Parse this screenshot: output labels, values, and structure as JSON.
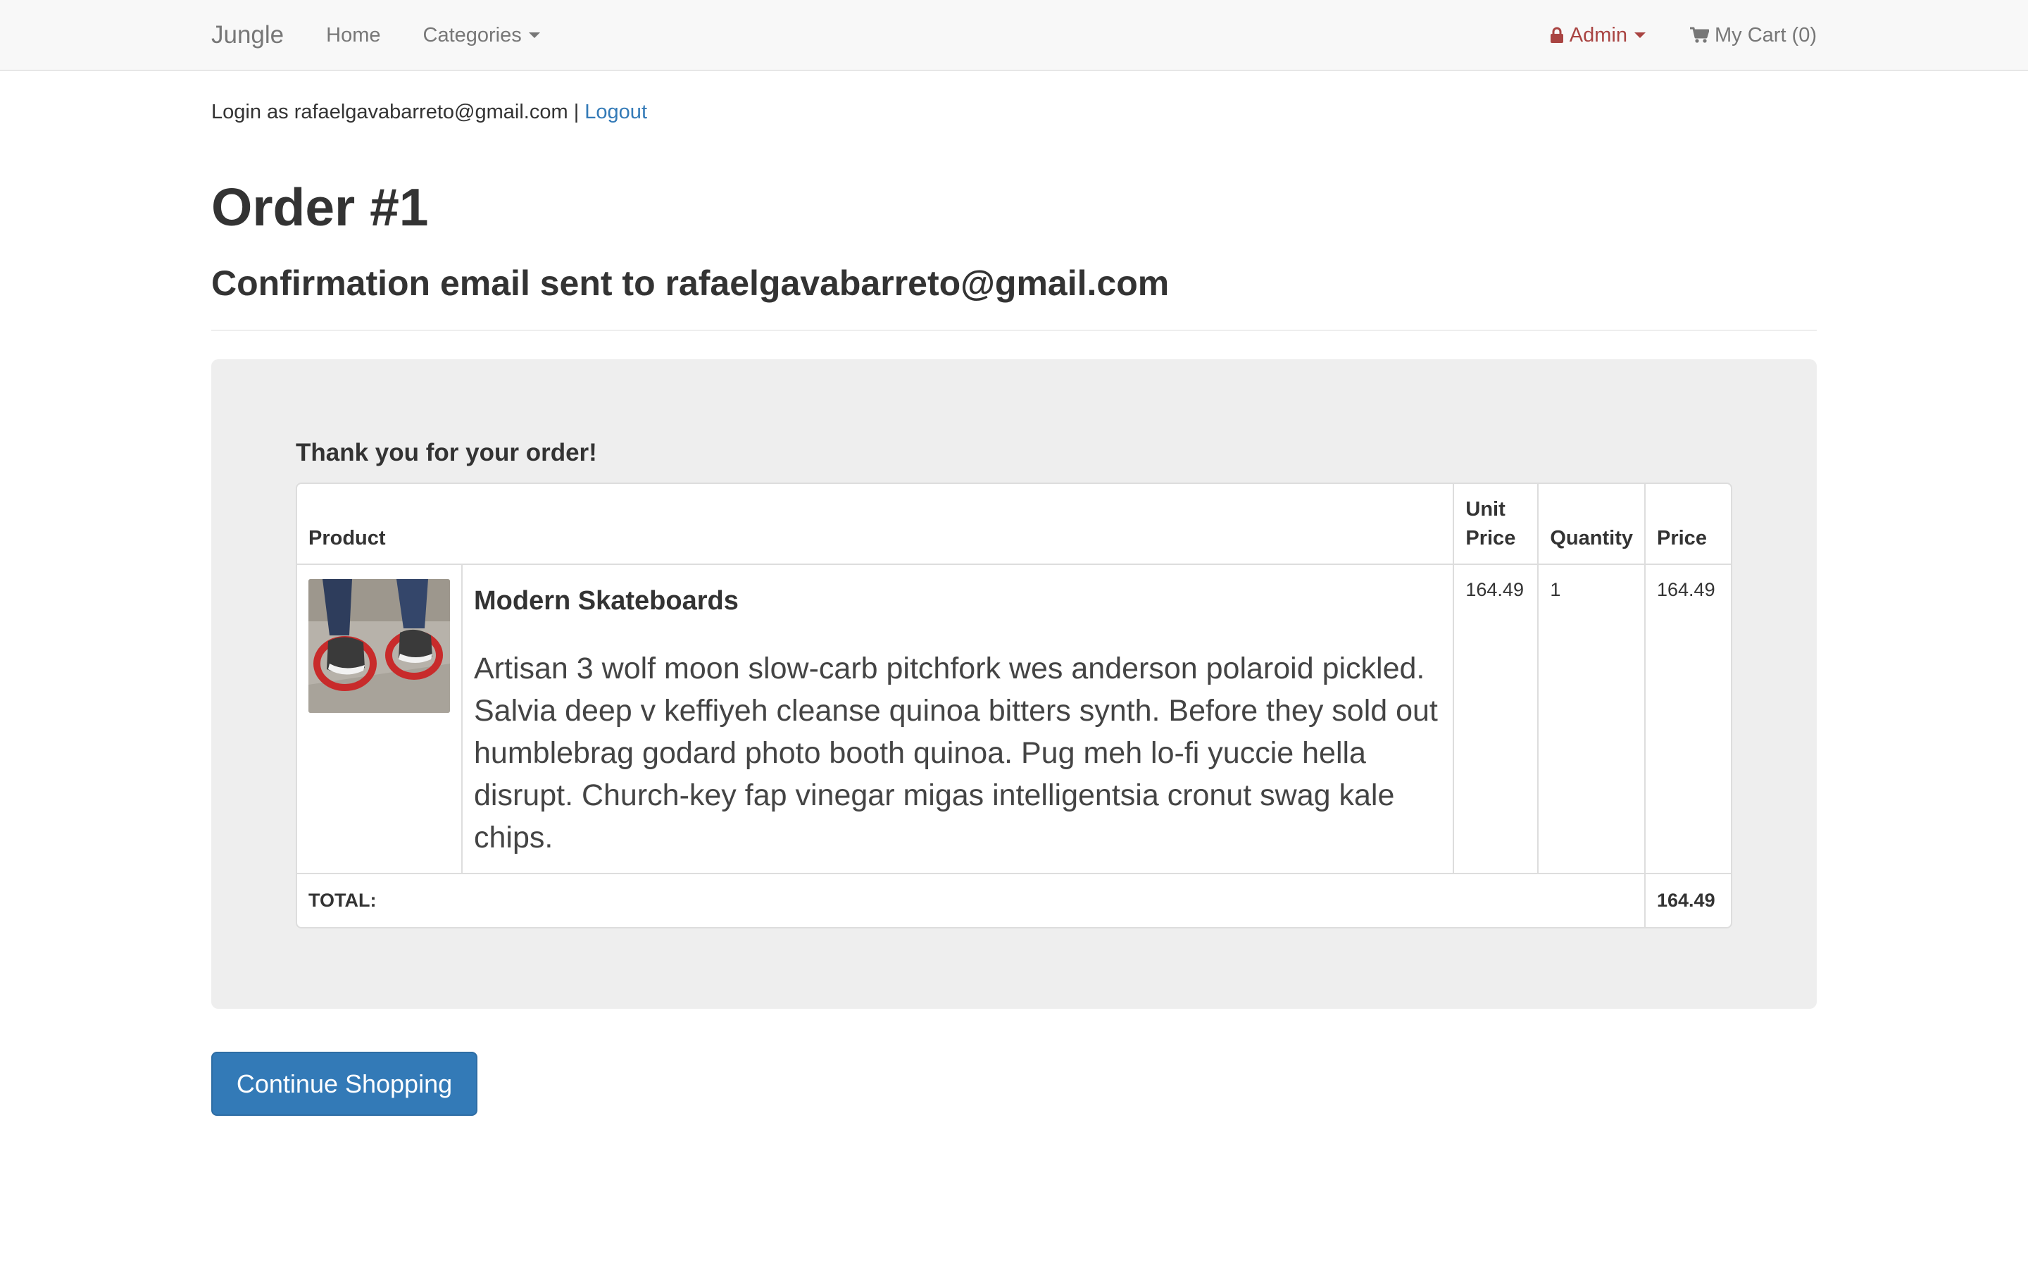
{
  "nav": {
    "brand": "Jungle",
    "home": "Home",
    "categories": "Categories",
    "admin": "Admin",
    "cart": "My Cart (0)"
  },
  "session": {
    "login_prefix": "Login as",
    "email": "rafaelgavabarreto@gmail.com",
    "separator": "|",
    "logout": "Logout"
  },
  "order": {
    "title": "Order #1",
    "confirmation": "Confirmation email sent to rafaelgavabarreto@gmail.com",
    "thanks": "Thank you for your order!"
  },
  "table": {
    "headers": {
      "product": "Product",
      "unit_price_line1": "Unit",
      "unit_price_line2": "Price",
      "quantity": "Quantity",
      "price": "Price"
    },
    "items": [
      {
        "name": "Modern Skateboards",
        "description": "Artisan 3 wolf moon slow-carb pitchfork wes anderson polaroid pickled. Salvia deep v keffiyeh cleanse quinoa bitters synth. Before they sold out humblebrag godard photo booth quinoa. Pug meh lo-fi yuccie hella disrupt. Church-key fap vinegar migas intelligentsia cronut swag kale chips.",
        "unit_price": "164.49",
        "quantity": "1",
        "price": "164.49"
      }
    ],
    "total_label": "TOTAL:",
    "total_value": "164.49"
  },
  "actions": {
    "continue": "Continue Shopping"
  },
  "icons": {
    "admin": "lock-icon",
    "cart": "shopping-cart-icon",
    "dropdown": "caret-down-icon"
  },
  "colors": {
    "link": "#337ab7",
    "admin": "#a94442",
    "button": "#337ab7"
  }
}
